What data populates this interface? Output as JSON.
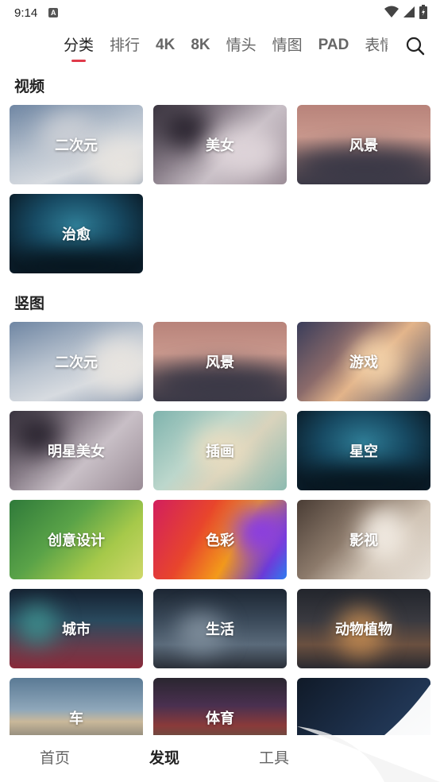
{
  "status": {
    "time": "9:14",
    "notif_glyph": "A"
  },
  "tabs": [
    {
      "label": "分类",
      "active": true
    },
    {
      "label": "排行"
    },
    {
      "label": "4K"
    },
    {
      "label": "8K"
    },
    {
      "label": "情头"
    },
    {
      "label": "情图"
    },
    {
      "label": "PAD"
    },
    {
      "label": "表情"
    }
  ],
  "sections": {
    "video": {
      "title": "视频",
      "items": [
        {
          "label": "二次元",
          "icon": "anime-tile"
        },
        {
          "label": "美女",
          "icon": "beauty-tile"
        },
        {
          "label": "风景",
          "icon": "landscape-tile"
        },
        {
          "label": "治愈",
          "icon": "healing-tile"
        }
      ]
    },
    "portrait": {
      "title": "竖图",
      "items": [
        {
          "label": "二次元"
        },
        {
          "label": "风景"
        },
        {
          "label": "游戏"
        },
        {
          "label": "明星美女"
        },
        {
          "label": "插画"
        },
        {
          "label": "星空"
        },
        {
          "label": "创意设计"
        },
        {
          "label": "色彩"
        },
        {
          "label": "影视"
        },
        {
          "label": "城市"
        },
        {
          "label": "生活"
        },
        {
          "label": "动物植物"
        },
        {
          "label": "车"
        },
        {
          "label": "体育"
        }
      ]
    }
  },
  "bottom_nav": [
    {
      "label": "首页"
    },
    {
      "label": "发现",
      "active": true
    },
    {
      "label": "工具"
    }
  ],
  "colors": {
    "accent": "#e03a4a",
    "text": "#222222",
    "muted": "#666666"
  }
}
